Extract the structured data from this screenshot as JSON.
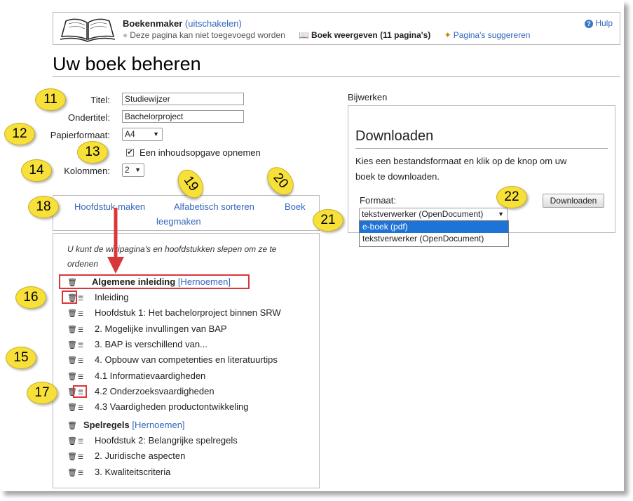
{
  "header": {
    "app_name": "Boekenmaker",
    "disable_link": "(uitschakelen)",
    "cannot_add": "Deze pagina kan niet toegevoegd worden",
    "show_book": "Boek weergeven (11 pagina's)",
    "suggest": "Pagina's suggereren",
    "help": "Hulp"
  },
  "page_title": "Uw boek beheren",
  "form": {
    "title_label": "Titel:",
    "title_value": "Studiewijzer",
    "subtitle_label": "Ondertitel:",
    "subtitle_value": "Bachelorproject",
    "paper_label": "Papierformaat:",
    "paper_value": "A4",
    "toc_label": "Een inhoudsopgave opnemen",
    "columns_label": "Kolommen:",
    "columns_value": "2"
  },
  "actions": {
    "make_chapter": "Hoofdstuk maken",
    "sort": "Alfabetisch sorteren",
    "clear_a": "Boek",
    "clear_b": "leegmaken"
  },
  "list": {
    "hint": "U kunt de wikipagina's en hoofdstukken slepen om ze te ordenen",
    "rename": "[Hernoemen]",
    "chapter1": "Algemene inleiding",
    "chapter1_items": [
      "Inleiding",
      "Hoofdstuk 1: Het bachelorproject binnen SRW",
      "2. Mogelijke invullingen van BAP",
      "3. BAP is verschillend van...",
      "4. Opbouw van competenties en literatuurtips",
      "4.1 Informatievaardigheden",
      "4.2 Onderzoeksvaardigheden",
      "4.3 Vaardigheden productontwikkeling"
    ],
    "chapter2": "Spelregels",
    "chapter2_items": [
      "Hoofdstuk 2: Belangrijke spelregels",
      "2. Juridische aspecten",
      "3. Kwaliteitscriteria"
    ]
  },
  "right": {
    "update": "Bijwerken",
    "download_heading": "Downloaden",
    "download_desc_1": "Kies een bestandsformaat en klik op de knop om uw",
    "download_desc_2": "boek te downloaden.",
    "format_label": "Formaat:",
    "format_value": "tekstverwerker (OpenDocument)",
    "format_options": [
      "e-boek (pdf)",
      "tekstverwerker (OpenDocument)"
    ],
    "download_button": "Downloaden"
  },
  "callouts": [
    "11",
    "12",
    "13",
    "14",
    "15",
    "16",
    "17",
    "18",
    "19",
    "20",
    "21",
    "22"
  ],
  "colors": {
    "link": "#3366bb",
    "callout": "#f7e03a",
    "highlight": "#d9383a",
    "selected": "#1e73d6"
  }
}
